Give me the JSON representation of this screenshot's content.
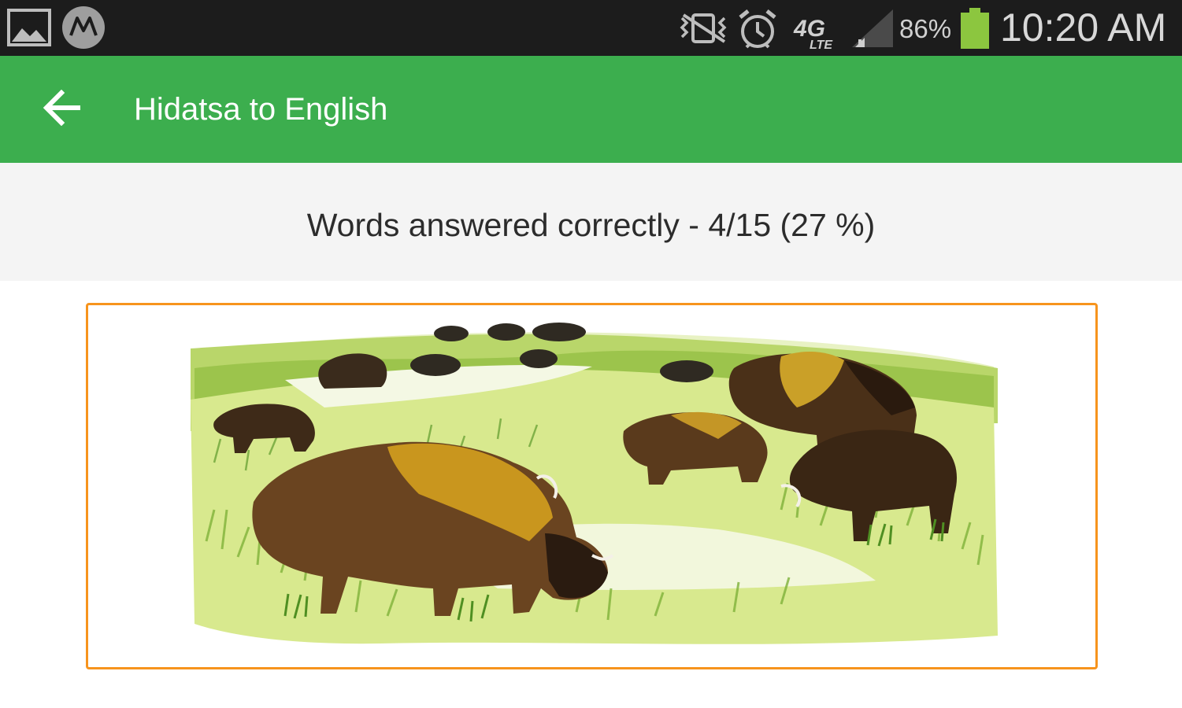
{
  "status_bar": {
    "battery_percent": "86%",
    "time": "10:20 AM",
    "network_badge": "4G",
    "network_sub": "LTE",
    "icons": [
      "gallery-icon",
      "motorola-icon",
      "vibrate-icon",
      "alarm-icon",
      "lte-icon",
      "signal-icon",
      "battery-icon"
    ],
    "battery_color": "#8cc63f",
    "background": "#1c1c1c"
  },
  "toolbar": {
    "back_icon": "arrow-left-icon",
    "title": "Hidatsa to English",
    "background": "#3cae4e"
  },
  "quiz": {
    "score_text": "Words answered correctly - 4/15 (27 %)",
    "correct": 4,
    "total": 15,
    "percent": 27
  },
  "picture": {
    "subject": "buffalo-herd-illustration",
    "border_color": "#f7941d"
  }
}
